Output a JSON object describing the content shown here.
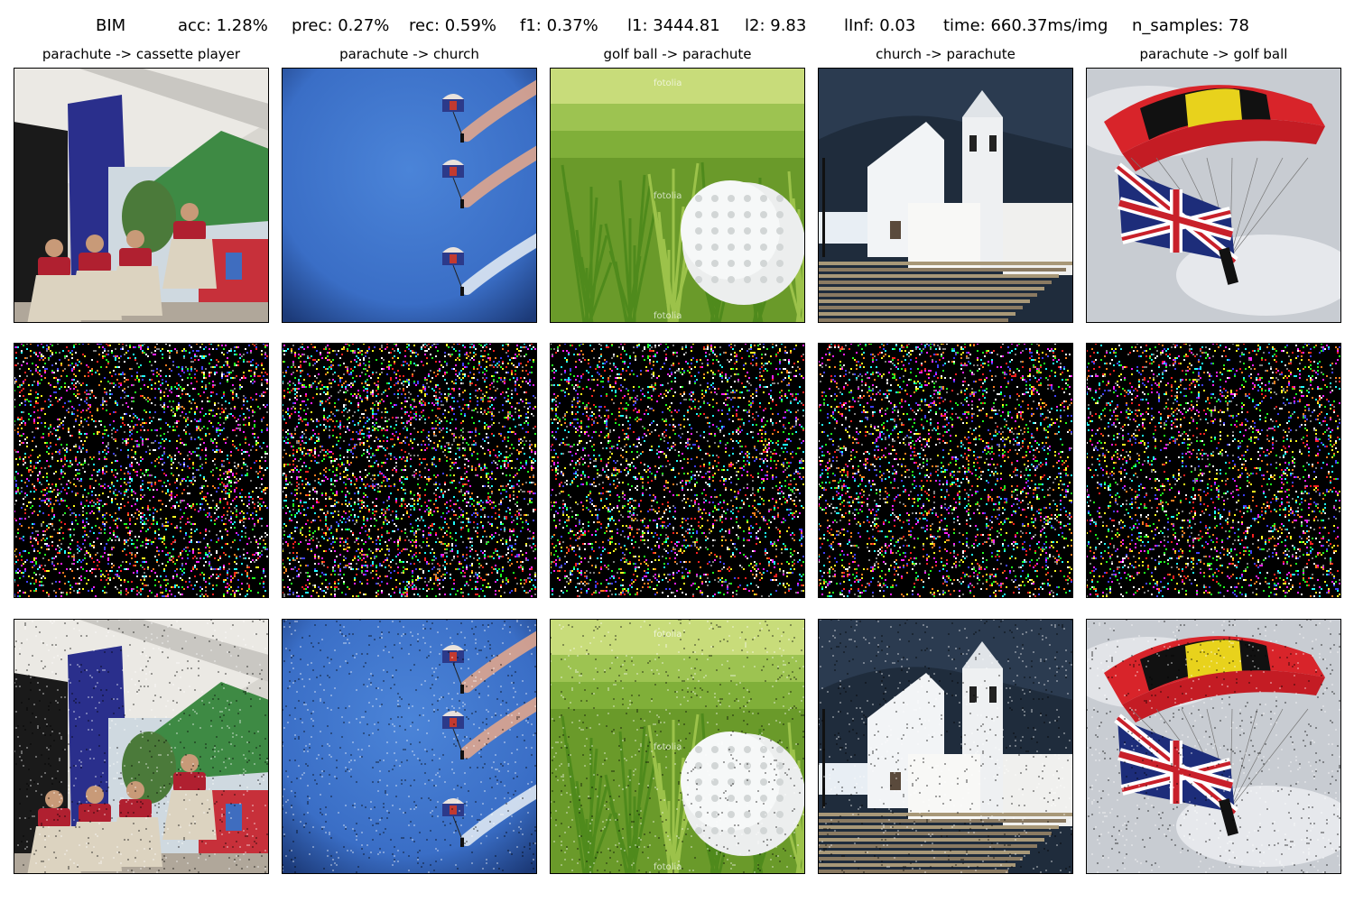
{
  "figure": {
    "method": "BIM",
    "metrics": [
      {
        "key": "acc",
        "text": "acc: 1.28%"
      },
      {
        "key": "prec",
        "text": "prec: 0.27%"
      },
      {
        "key": "rec",
        "text": "rec: 0.59%"
      },
      {
        "key": "f1",
        "text": "f1: 0.37%"
      },
      {
        "key": "l1",
        "text": "l1: 3444.81"
      },
      {
        "key": "l2",
        "text": "l2: 9.83"
      },
      {
        "key": "linf",
        "text": "lInf: 0.03"
      },
      {
        "key": "time",
        "text": "time: 660.37ms/img"
      },
      {
        "key": "n_samples",
        "text": "n_samples: 78"
      }
    ]
  },
  "columns": [
    {
      "title": "parachute -> cassette player",
      "scene": "dancers"
    },
    {
      "title": "parachute -> church",
      "scene": "skydivers"
    },
    {
      "title": "golf ball -> parachute",
      "scene": "golfball"
    },
    {
      "title": "church -> parachute",
      "scene": "church"
    },
    {
      "title": "parachute -> golf ball",
      "scene": "flagchute"
    }
  ],
  "rows": [
    {
      "role": "original"
    },
    {
      "role": "perturbation"
    },
    {
      "role": "adversarial"
    }
  ],
  "watermark": "fotolia"
}
